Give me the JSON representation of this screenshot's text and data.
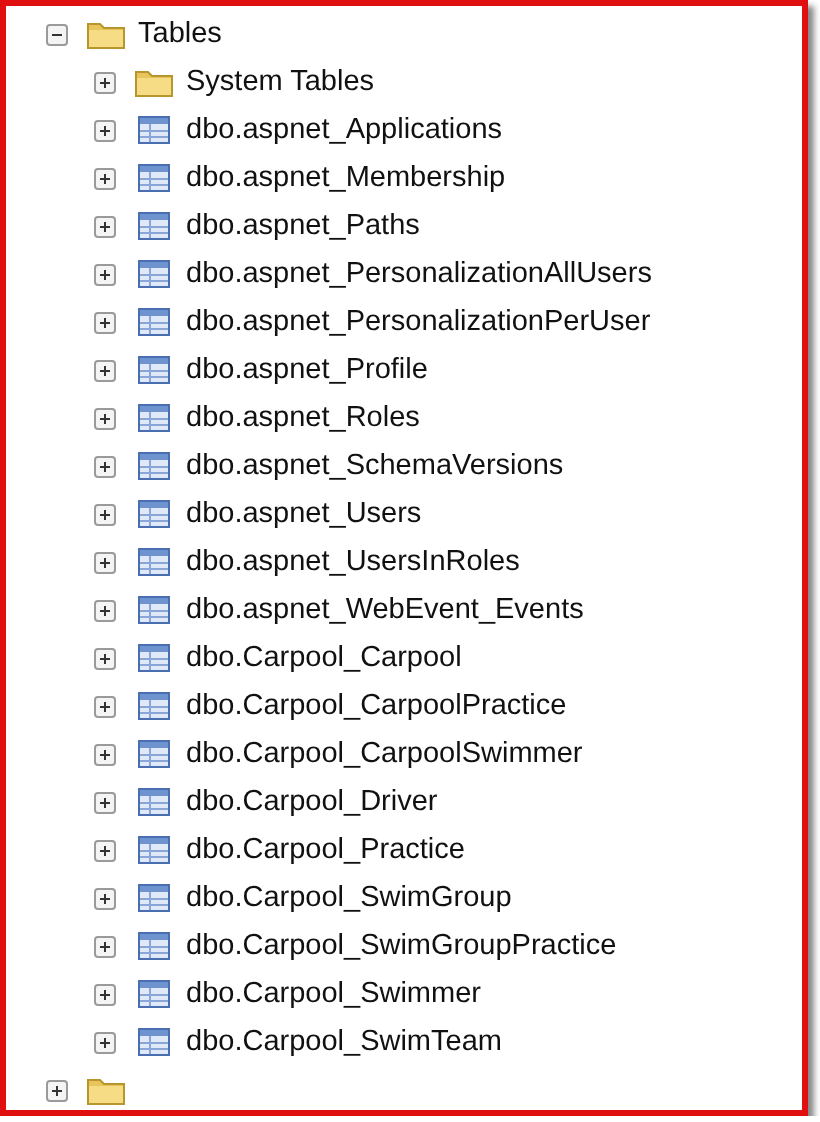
{
  "tree": {
    "label": "Tables",
    "expanded": true,
    "children": [
      {
        "label": "System Tables",
        "kind": "folder",
        "expanded": false
      },
      {
        "label": "dbo.aspnet_Applications",
        "kind": "table",
        "expanded": false
      },
      {
        "label": "dbo.aspnet_Membership",
        "kind": "table",
        "expanded": false
      },
      {
        "label": "dbo.aspnet_Paths",
        "kind": "table",
        "expanded": false
      },
      {
        "label": "dbo.aspnet_PersonalizationAllUsers",
        "kind": "table",
        "expanded": false
      },
      {
        "label": "dbo.aspnet_PersonalizationPerUser",
        "kind": "table",
        "expanded": false
      },
      {
        "label": "dbo.aspnet_Profile",
        "kind": "table",
        "expanded": false
      },
      {
        "label": "dbo.aspnet_Roles",
        "kind": "table",
        "expanded": false
      },
      {
        "label": "dbo.aspnet_SchemaVersions",
        "kind": "table",
        "expanded": false
      },
      {
        "label": "dbo.aspnet_Users",
        "kind": "table",
        "expanded": false
      },
      {
        "label": "dbo.aspnet_UsersInRoles",
        "kind": "table",
        "expanded": false
      },
      {
        "label": "dbo.aspnet_WebEvent_Events",
        "kind": "table",
        "expanded": false
      },
      {
        "label": "dbo.Carpool_Carpool",
        "kind": "table",
        "expanded": false
      },
      {
        "label": "dbo.Carpool_CarpoolPractice",
        "kind": "table",
        "expanded": false
      },
      {
        "label": "dbo.Carpool_CarpoolSwimmer",
        "kind": "table",
        "expanded": false
      },
      {
        "label": "dbo.Carpool_Driver",
        "kind": "table",
        "expanded": false
      },
      {
        "label": "dbo.Carpool_Practice",
        "kind": "table",
        "expanded": false
      },
      {
        "label": "dbo.Carpool_SwimGroup",
        "kind": "table",
        "expanded": false
      },
      {
        "label": "dbo.Carpool_SwimGroupPractice",
        "kind": "table",
        "expanded": false
      },
      {
        "label": "dbo.Carpool_Swimmer",
        "kind": "table",
        "expanded": false
      },
      {
        "label": "dbo.Carpool_SwimTeam",
        "kind": "table",
        "expanded": false
      }
    ]
  },
  "next_node": {
    "kind": "folder",
    "expanded": false
  }
}
